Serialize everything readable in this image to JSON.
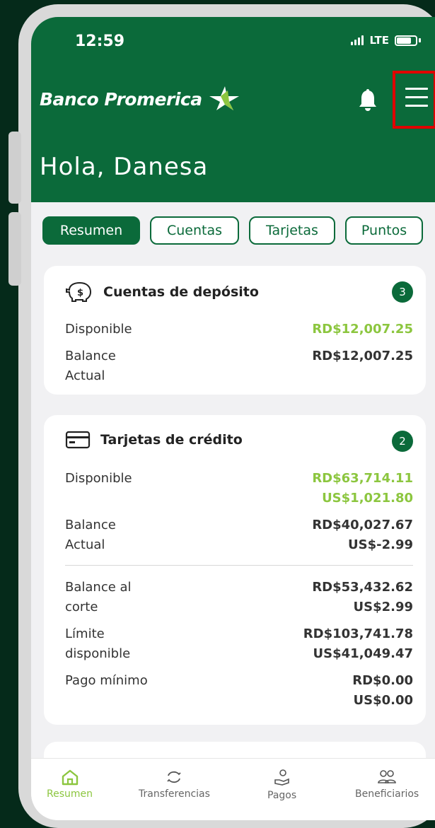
{
  "status": {
    "time": "12:59",
    "network": "LTE"
  },
  "header": {
    "brand": "Banco Promerica",
    "greeting": "Hola, Danesa"
  },
  "tabs": [
    {
      "label": "Resumen",
      "active": true
    },
    {
      "label": "Cuentas",
      "active": false
    },
    {
      "label": "Tarjetas",
      "active": false
    },
    {
      "label": "Puntos",
      "active": false
    }
  ],
  "deposit": {
    "title": "Cuentas de depósito",
    "count": "3",
    "available_label": "Disponible",
    "available_value": "RD$12,007.25",
    "balance_label": "Balance Actual",
    "balance_value": "RD$12,007.25"
  },
  "credit": {
    "title": "Tarjetas de crédito",
    "count": "2",
    "available_label": "Disponible",
    "available_rd": "RD$63,714.11",
    "available_us": "US$1,021.80",
    "balance_label": "Balance Actual",
    "balance_rd": "RD$40,027.67",
    "balance_us": "US$-2.99",
    "cut_label": "Balance al corte",
    "cut_rd": "RD$53,432.62",
    "cut_us": "US$2.99",
    "limit_label": "Límite disponible",
    "limit_rd": "RD$103,741.78",
    "limit_us": "US$41,049.47",
    "min_label": "Pago mínimo",
    "min_rd": "RD$0.00",
    "min_us": "US$0.00"
  },
  "nav": [
    {
      "label": "Resumen",
      "icon": "home-icon",
      "active": true
    },
    {
      "label": "Transferencias",
      "icon": "transfer-icon",
      "active": false
    },
    {
      "label": "Pagos",
      "icon": "payment-icon",
      "active": false
    },
    {
      "label": "Beneficiarios",
      "icon": "people-icon",
      "active": false
    }
  ],
  "colors": {
    "brand_green": "#0b6a3a",
    "accent_green": "#8cc63f",
    "highlight": "#e00000"
  }
}
